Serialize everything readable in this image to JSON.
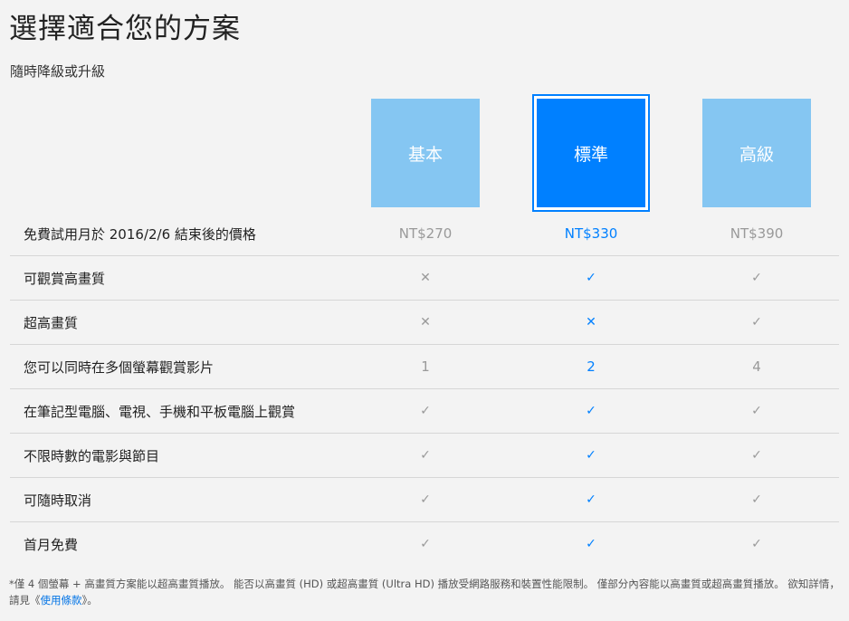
{
  "header": {
    "title": "選擇適合您的方案",
    "subtitle": "隨時降級或升級"
  },
  "plans": [
    {
      "label": "基本",
      "selected": false
    },
    {
      "label": "標準",
      "selected": true
    },
    {
      "label": "高級",
      "selected": false
    }
  ],
  "rows": [
    {
      "label": "免費試用月於 2016/2/6 結束後的價格",
      "values": [
        "NT$270",
        "NT$330",
        "NT$390"
      ]
    },
    {
      "label": "可觀賞高畫質",
      "values": [
        "✕",
        "✓",
        "✓"
      ]
    },
    {
      "label": "超高畫質",
      "values": [
        "✕",
        "✕",
        "✓"
      ]
    },
    {
      "label": "您可以同時在多個螢幕觀賞影片",
      "values": [
        "1",
        "2",
        "4"
      ]
    },
    {
      "label": "在筆記型電腦、電視、手機和平板電腦上觀賞",
      "values": [
        "✓",
        "✓",
        "✓"
      ]
    },
    {
      "label": "不限時數的電影與節目",
      "values": [
        "✓",
        "✓",
        "✓"
      ]
    },
    {
      "label": "可隨時取消",
      "values": [
        "✓",
        "✓",
        "✓"
      ]
    },
    {
      "label": "首月免費",
      "values": [
        "✓",
        "✓",
        "✓"
      ]
    }
  ],
  "footnote": {
    "text": "*僅 4 個螢幕 + 高畫質方案能以超高畫質播放。 能否以高畫質 (HD) 或超高畫質 (Ultra HD) 播放受網路服務和裝置性能限制。 僅部分內容能以高畫質或超高畫質播放。 欲知詳情，請見《",
    "link": "使用條款",
    "end": "》。"
  },
  "colors": {
    "accent": "#0080ff",
    "plan_unselected": "#85c6f2",
    "muted": "#999999"
  }
}
